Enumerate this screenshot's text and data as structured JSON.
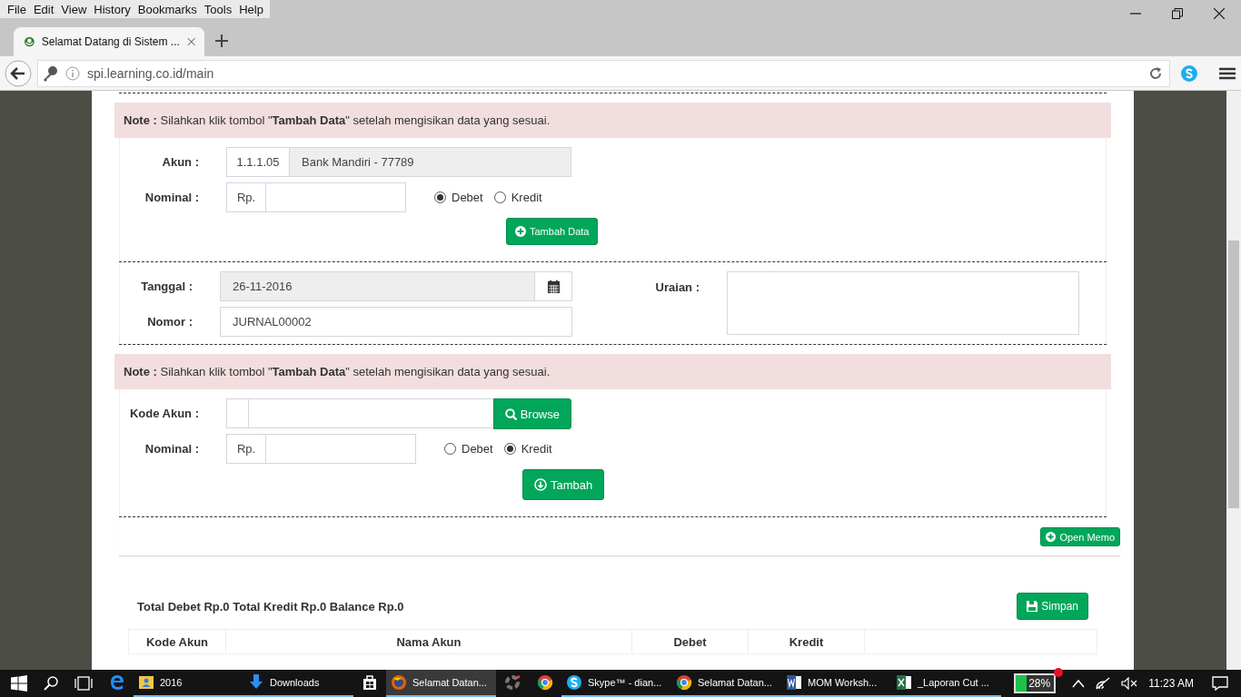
{
  "browser": {
    "menu": [
      "File",
      "Edit",
      "View",
      "History",
      "Bookmarks",
      "Tools",
      "Help"
    ],
    "tabs": [
      {
        "title": "Selamat Datang di Sistem ...",
        "selected": true
      }
    ],
    "address": "spi.learning.co.id/main"
  },
  "form": {
    "note_1": "**Note :** Silahkan klik tombol \"**Tambah Data**\" setelah mengisikan data yang sesuai.",
    "akun": {
      "label": "Akun :",
      "code": "1.1.1.05",
      "name": "Bank Mandiri - 77789"
    },
    "nominal_1": {
      "label": "Nominal :",
      "prefix": "Rp.",
      "options": [
        {
          "label": "Debet",
          "selected": true
        },
        {
          "label": "Kredit",
          "selected": false
        }
      ]
    },
    "button_1": "Tambah Data",
    "tanggal": {
      "label": "Tanggal :",
      "value": "26-11-2016"
    },
    "nomor": {
      "label": "Nomor :",
      "value": "JURNAL00002"
    },
    "uraian": {
      "label": "Uraian :"
    },
    "note_2": "**Note :** Silahkan klik tombol \"**Tambah Data**\" setelah mengisikan data yang sesuai.",
    "kode_akun": {
      "label": "Kode Akun :",
      "button": "Browse"
    },
    "nominal_2": {
      "label": "Nominal :",
      "prefix": "Rp.",
      "options": [
        {
          "label": "Debet",
          "selected": false
        },
        {
          "label": "Kredit",
          "selected": true
        }
      ]
    },
    "button_2": "Tambah"
  },
  "open_memo": "Open Memo",
  "totals": "Total Debet Rp.0 Total Kredit Rp.0 Balance Rp.0",
  "save_button": "Simpan",
  "table": {
    "columns": [
      "Kode Akun",
      "Nama Akun",
      "Debet",
      "Kredit"
    ]
  },
  "taskbar": {
    "apps": [
      {
        "kind": "edge",
        "running": false,
        "selected": false
      },
      {
        "kind": "folder",
        "label": "2016",
        "running": true,
        "selected": false
      },
      {
        "kind": "download",
        "label": "Downloads",
        "running": true,
        "selected": false
      },
      {
        "kind": "store",
        "running": false,
        "selected": false
      },
      {
        "kind": "firefox",
        "label": "Selamat Datan...",
        "running": true,
        "selected": true
      },
      {
        "kind": "ring",
        "running": false,
        "selected": false
      },
      {
        "kind": "chrome",
        "running": false,
        "selected": false
      },
      {
        "kind": "skype",
        "label": "Skype™ - dian...",
        "running": true,
        "selected": false
      },
      {
        "kind": "chrome",
        "label": "Selamat Datan...",
        "running": true,
        "selected": false
      },
      {
        "kind": "word",
        "label": "MOM Worksh...",
        "running": true,
        "selected": false
      },
      {
        "kind": "excel",
        "label": "_Laporan Cut ...",
        "running": true,
        "selected": false
      }
    ],
    "battery": "28%",
    "time": "11:23 AM"
  }
}
